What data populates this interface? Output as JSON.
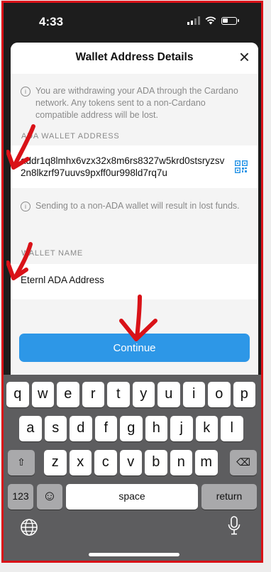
{
  "status_bar": {
    "time": "4:33"
  },
  "sheet": {
    "title": "Wallet Address Details",
    "close_glyph": "×",
    "withdraw_notice": "You are withdrawing your ADA through the Cardano network. Any tokens sent to a non-Cardano compatible address will be lost.",
    "address_label": "ADA WALLET ADDRESS",
    "address_value": "addr1q8lmhx6vzx32x8m6rs8327w5krd0stsryzsv2n8lkzrf97uuvs9pxff0ur998ld7rq7u",
    "address_notice": "Sending to a non-ADA wallet will result in lost funds.",
    "name_label": "WALLET NAME",
    "name_value": "Eternl ADA Address",
    "info_glyph": "i",
    "qr_icon": "qr-code-icon"
  },
  "continue_label": "Continue",
  "keyboard": {
    "row1": [
      "q",
      "w",
      "e",
      "r",
      "t",
      "y",
      "u",
      "i",
      "o",
      "p"
    ],
    "row2": [
      "a",
      "s",
      "d",
      "f",
      "g",
      "h",
      "j",
      "k",
      "l"
    ],
    "row3": [
      "z",
      "x",
      "c",
      "v",
      "b",
      "n",
      "m"
    ],
    "shift_glyph": "⇧",
    "delete_glyph": "⌫",
    "numbers_label": "123",
    "emoji_glyph": "☺",
    "space_label": "space",
    "return_label": "return"
  },
  "colors": {
    "accent": "#2d97e7",
    "annotation_red": "#d91218"
  }
}
